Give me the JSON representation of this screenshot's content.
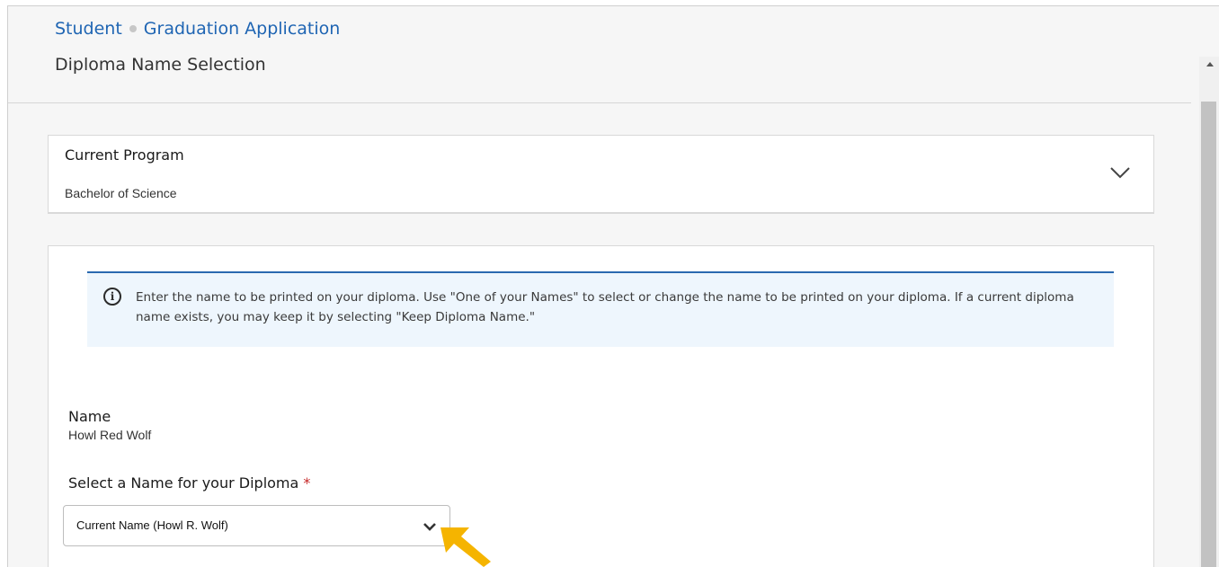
{
  "breadcrumb": {
    "root": "Student",
    "current": "Graduation Application"
  },
  "page": {
    "title": "Diploma Name Selection"
  },
  "program": {
    "label": "Current Program",
    "value": "Bachelor of Science"
  },
  "info": {
    "text": "Enter the name to be printed on your diploma. Use \"One of your Names\" to select or change the name to be printed on your diploma. If a current diploma name exists, you may keep it by selecting \"Keep Diploma Name.\""
  },
  "name": {
    "label": "Name",
    "value": "Howl Red Wolf"
  },
  "diploma_select": {
    "label": "Select a Name for your Diploma",
    "required_mark": "*",
    "selected": "Current Name (Howl R. Wolf)"
  },
  "colors": {
    "link": "#1f65b3",
    "info_bg": "#eef6fd",
    "info_border": "#2a69b0",
    "required": "#c62828",
    "pointer": "#f5b400"
  }
}
